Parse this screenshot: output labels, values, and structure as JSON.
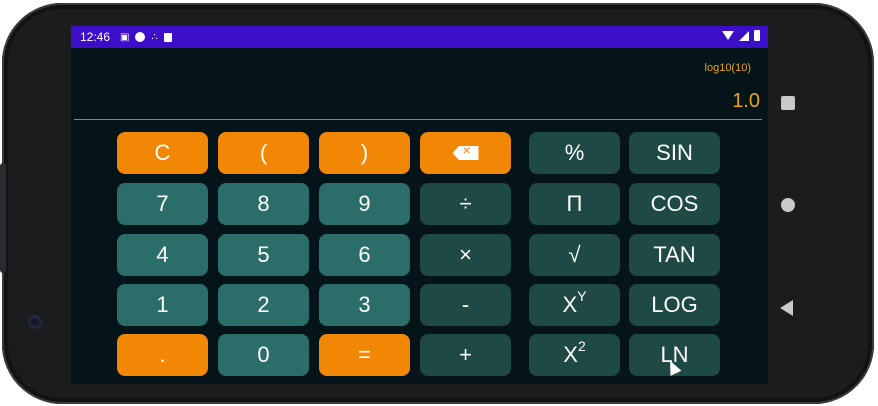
{
  "status_bar": {
    "time": "12:46",
    "icons": [
      "a-icon",
      "vpn-icon",
      "dots-icon",
      "sd-card-icon",
      "wifi-icon",
      "signal-icon",
      "battery-icon"
    ]
  },
  "display": {
    "expression": "log10(10)",
    "result": "1.0"
  },
  "keys": {
    "clear": "C",
    "open_paren": "(",
    "close_paren": ")",
    "backspace": "backspace-icon",
    "percent": "%",
    "sin": "SIN",
    "seven": "7",
    "eight": "8",
    "nine": "9",
    "divide": "÷",
    "pi": "Π",
    "cos": "COS",
    "four": "4",
    "five": "5",
    "six": "6",
    "multiply": "×",
    "sqrt": "√",
    "tan": "TAN",
    "one": "1",
    "two": "2",
    "three": "3",
    "minus": "-",
    "power_base": "X",
    "power_exp": "Y",
    "log": "LOG",
    "dot": ".",
    "zero": "0",
    "equals": "=",
    "plus": "+",
    "square_base": "X",
    "square_exp": "2",
    "ln": "LN"
  },
  "colors": {
    "accent_orange": "#f28705",
    "digit_teal": "#2b6d68",
    "operator_dark_teal": "#1e4944",
    "status_bar": "#3c0ec8",
    "display_text": "#e8a317",
    "background": "#051419"
  }
}
